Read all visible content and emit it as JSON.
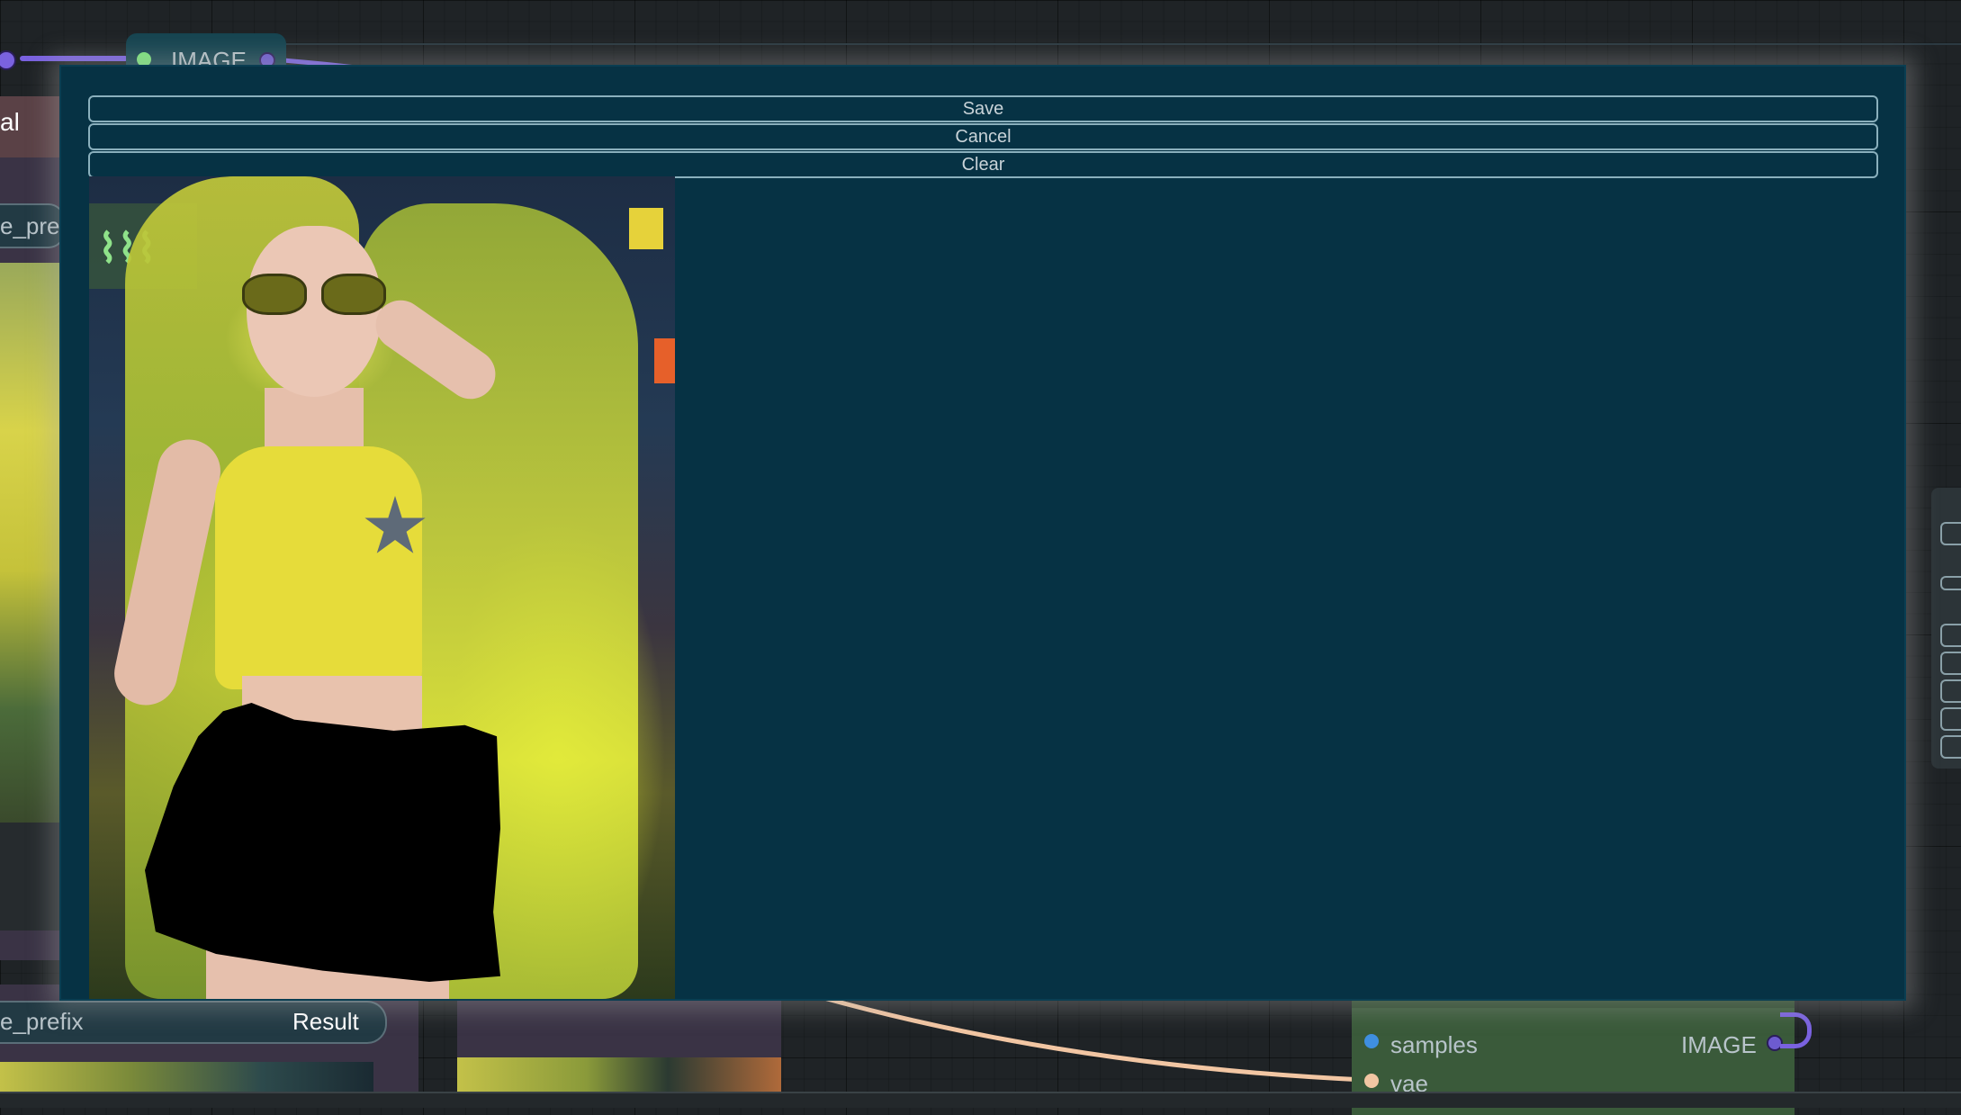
{
  "mask_editor": {
    "buttons": {
      "save": "Save",
      "cancel": "Cancel",
      "clear": "Clear"
    }
  },
  "canvas": {
    "image_pill": {
      "label": "IMAGE"
    },
    "left_node": {
      "title_fragment": "al",
      "prefix_fragment": "e_pref"
    },
    "bottom_left_node": {
      "prefix_label": "e_prefix",
      "result_label": "Result"
    },
    "vae_decode_node": {
      "inputs": [
        "samples",
        "vae"
      ],
      "output": "IMAGE"
    }
  },
  "colors": {
    "modal_bg": "#063244",
    "button_border": "#8ab0bd",
    "mask": "#000000",
    "link_purple": "#7a62e0",
    "link_peach": "#f2c6a3",
    "samples_dot": "#3f8fe0",
    "image_dot_green": "#7de67d"
  }
}
